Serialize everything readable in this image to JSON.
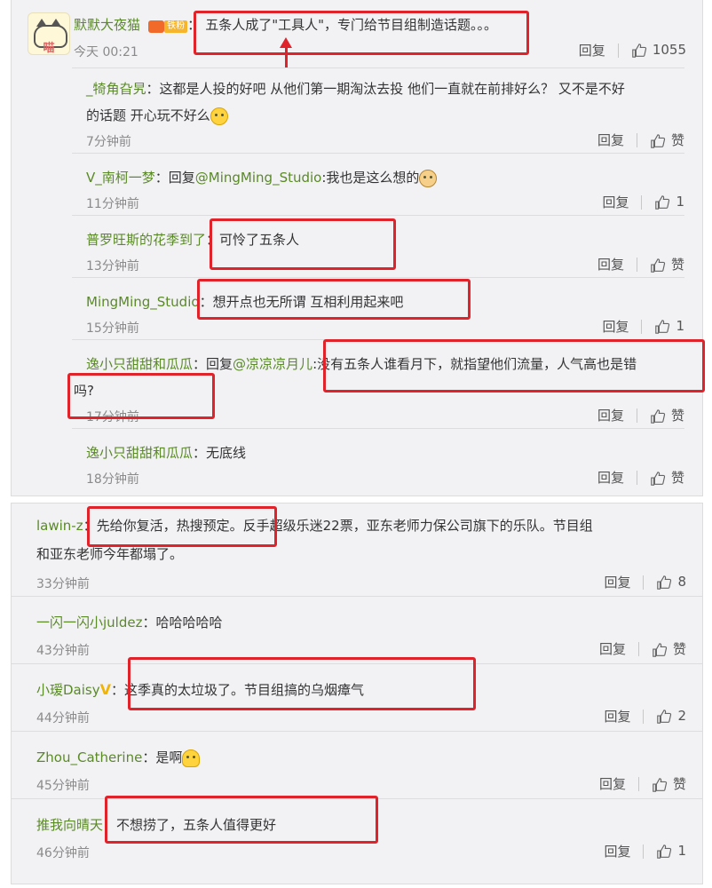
{
  "main_comment": {
    "avatar_text": "喵",
    "username": "默默大夜猫",
    "fan_badge": "铁粉",
    "text": "五条人成了\"工具人\"，专门给节目组制造话题。。。",
    "time": "今天 00:21",
    "reply_label": "回复",
    "likes": "1055"
  },
  "replies": [
    {
      "username": "_犄角旮旯",
      "lines": [
        "这都是人投的好吧 从他们第一期淘汰去投 他们一直就在前排好么？ 又不是不好",
        "的话题 开心玩不好么"
      ],
      "emoji": "smile-emoji",
      "time": "7分钟前",
      "reply_label": "回复",
      "likes": "赞"
    },
    {
      "username": "V_南柯一梦",
      "reply_prefix": "回复",
      "mention": "@MingMing_Studio",
      "text": "我也是这么想的",
      "emoji": "dog-emoji",
      "time": "11分钟前",
      "reply_label": "回复",
      "likes": "1"
    },
    {
      "username": "普罗旺斯的花季到了",
      "text": "可怜了五条人",
      "time": "13分钟前",
      "reply_label": "回复",
      "likes": "赞"
    },
    {
      "username": "MingMing_Studio",
      "text": "想开点也无所谓 互相利用起来吧",
      "time": "15分钟前",
      "reply_label": "回复",
      "likes": "1"
    },
    {
      "username": "逸小只甜甜和瓜瓜",
      "reply_prefix": "回复",
      "mention": "@凉凉凉月儿",
      "lines": [
        "没有五条人谁看月下，就指望他们流量，人气高也是错",
        "吗?"
      ],
      "time": "17分钟前",
      "reply_label": "回复",
      "likes": "赞"
    },
    {
      "username": "逸小只甜甜和瓜瓜",
      "text": "无底线",
      "time": "18分钟前",
      "reply_label": "回复",
      "likes": "赞"
    }
  ],
  "comments2": [
    {
      "username": "lawin-z",
      "lines": [
        "先给你复活，热搜预定。反手超级乐迷22票，亚东老师力保公司旗下的乐队。节目组",
        "和亚东老师今年都塌了。"
      ],
      "time": "33分钟前",
      "reply_label": "回复",
      "likes": "8"
    },
    {
      "username": "一闪一闪小juldez",
      "text": "哈哈哈哈哈",
      "time": "43分钟前",
      "reply_label": "回复",
      "likes": "赞"
    },
    {
      "username": "小瑷Daisy",
      "vip_mark": "V",
      "text": "这季真的太垃圾了。节目组搞的乌烟瘴气",
      "time": "44分钟前",
      "reply_label": "回复",
      "likes": "2"
    },
    {
      "username": "Zhou_Catherine",
      "text": "是啊",
      "emoji": "pray-emoji",
      "time": "45分钟前",
      "reply_label": "回复",
      "likes": "赞"
    },
    {
      "username": "推我向晴天",
      "text": "不想捞了，五条人值得更好",
      "time": "46分钟前",
      "reply_label": "回复",
      "likes": "1"
    }
  ],
  "colors": {
    "username": "#5a8a26",
    "highlight": "#e0222a",
    "time": "#8a8a8a"
  }
}
